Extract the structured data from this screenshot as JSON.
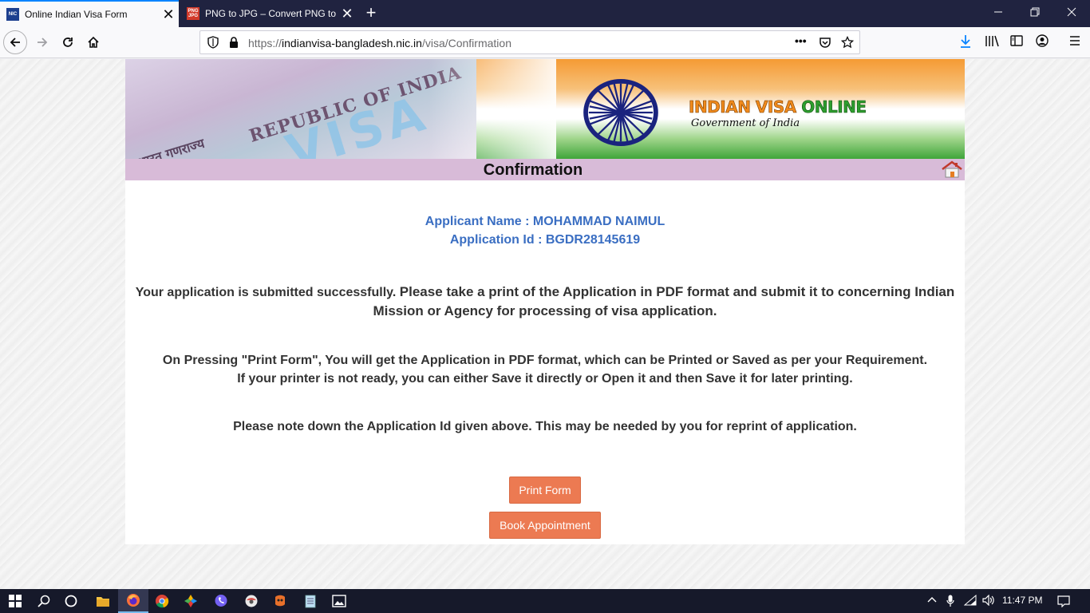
{
  "browser": {
    "tabs": [
      {
        "title": "Online Indian Visa Form",
        "favicon_text": "NIC",
        "active": true
      },
      {
        "title": "PNG to JPG – Convert PNG to J",
        "favicon_text": "PNG JPG",
        "active": false
      }
    ],
    "url": {
      "scheme": "https://",
      "host": "indianvisa-bangladesh.nic.in",
      "path": "/visa/Confirmation"
    },
    "url_actions_icon": "•••"
  },
  "banner": {
    "card_text_1": "REPUBLIC OF INDIA",
    "card_text_2": "VISA",
    "card_text_3": "भारत गणराज्य",
    "logo": {
      "part1": "INDIAN",
      "part2": "VISA",
      "part3": "ONLINE"
    },
    "subtitle": "Government of India"
  },
  "page": {
    "heading": "Confirmation",
    "applicant_name": "Applicant Name : MOHAMMAD NAIMUL",
    "application_id": "Application Id : BGDR28145619",
    "message1_prefix": "Your application is submitted successfully.",
    "message1_bold": "Please take a print of the Application in PDF format and submit it to concerning Indian Mission or Agency for processing of visa application.",
    "message2_line1": "On Pressing \"Print Form\", You will get the Application in PDF format, which can be Printed or Saved as per your Requirement.",
    "message2_line2": "If your printer is not ready, you can either Save it directly or Open it and then Save it for later printing.",
    "message3": "Please note down the Application Id given above. This may be needed by you for reprint of application.",
    "print_button": "Print Form",
    "book_button": "Book Appointment"
  },
  "taskbar": {
    "clock": "11:47 PM"
  },
  "colors": {
    "tab_strip": "#202340",
    "accent": "#0a84ff",
    "confirmation_bar": "#d8bbd8",
    "applicant_text": "#3a6ec2",
    "button": "#ec7a52",
    "taskbar": "#16192a"
  }
}
